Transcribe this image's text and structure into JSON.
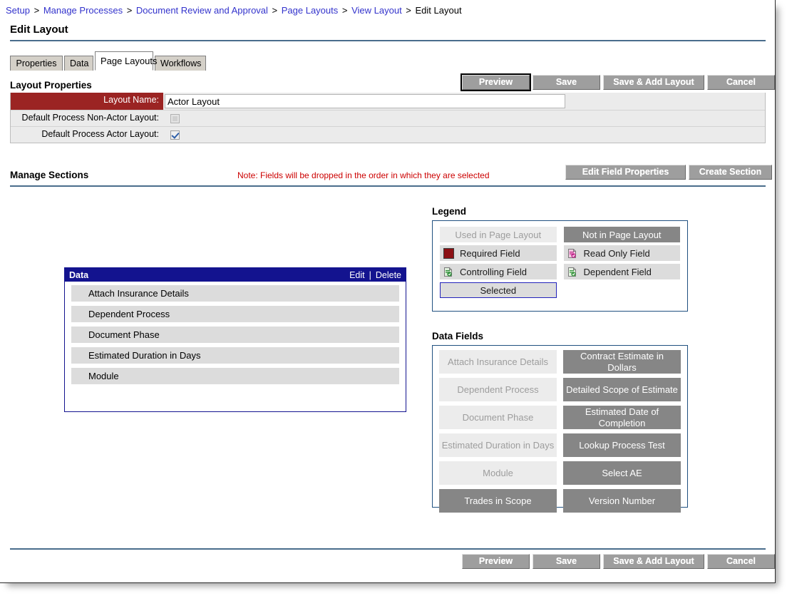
{
  "breadcrumb": {
    "items": [
      {
        "label": "Setup",
        "link": true
      },
      {
        "label": "Manage Processes",
        "link": true
      },
      {
        "label": "Document Review and Approval",
        "link": true
      },
      {
        "label": "Page Layouts",
        "link": true
      },
      {
        "label": "View Layout",
        "link": true
      },
      {
        "label": "Edit Layout",
        "link": false
      }
    ],
    "separator": ">"
  },
  "page": {
    "title": "Edit Layout"
  },
  "tabs": [
    {
      "label": "Properties",
      "active": false
    },
    {
      "label": "Data",
      "active": false
    },
    {
      "label": "Page Layouts",
      "active": true
    },
    {
      "label": "Workflows",
      "active": false
    }
  ],
  "layout_properties": {
    "heading": "Layout Properties",
    "rows": [
      {
        "label": "Layout Name:",
        "required": true,
        "type": "text",
        "value": "Actor Layout",
        "placeholder": ""
      },
      {
        "label": "Default Process Non-Actor Layout:",
        "required": false,
        "type": "checkbox",
        "checked": false,
        "disabled": true
      },
      {
        "label": "Default Process Actor Layout:",
        "required": false,
        "type": "checkbox",
        "checked": true,
        "disabled": false
      }
    ]
  },
  "top_buttons": [
    {
      "label": "Preview",
      "focused": true
    },
    {
      "label": "Save",
      "focused": false
    },
    {
      "label": "Save & Add Layout",
      "focused": false
    },
    {
      "label": "Cancel",
      "focused": false
    }
  ],
  "bottom_buttons": [
    {
      "label": "Preview",
      "focused": false
    },
    {
      "label": "Save",
      "focused": false
    },
    {
      "label": "Save & Add Layout",
      "focused": false
    },
    {
      "label": "Cancel",
      "focused": false
    }
  ],
  "manage_sections": {
    "heading": "Manage Sections",
    "note": "Note: Fields will be dropped in the order in which they are selected",
    "buttons": [
      {
        "label": "Edit Field Properties"
      },
      {
        "label": "Create Section"
      }
    ]
  },
  "section_panel": {
    "title": "Data",
    "edit_label": "Edit",
    "delete_label": "Delete",
    "separator": "|",
    "fields": [
      "Attach Insurance Details",
      "Dependent Process",
      "Document Phase",
      "Estimated Duration in Days",
      "Module"
    ]
  },
  "legend": {
    "heading": "Legend",
    "rows": [
      [
        {
          "label": "Used in Page Layout",
          "style": "used",
          "icon": null
        },
        {
          "label": "Not in Page Layout",
          "style": "notused",
          "icon": null
        }
      ],
      [
        {
          "label": "Required Field",
          "style": "item",
          "icon": "required-square-icon"
        },
        {
          "label": "Read Only Field",
          "style": "item",
          "icon": "read-only-document-icon"
        }
      ],
      [
        {
          "label": "Controlling Field",
          "style": "item",
          "icon": "controlling-document-icon"
        },
        {
          "label": "Dependent Field",
          "style": "item",
          "icon": "dependent-document-icon"
        }
      ],
      [
        {
          "label": "Selected",
          "style": "selected",
          "icon": null
        },
        {
          "label": "",
          "style": "empty",
          "icon": null
        }
      ]
    ],
    "colors": {
      "required_swatch": "#8b0f13",
      "used_bg": "#ececec",
      "notused_bg": "#868686",
      "selected_border": "#2222bb",
      "panel_border": "#205080"
    }
  },
  "data_fields": {
    "heading": "Data Fields",
    "rows": [
      [
        {
          "label": "Attach Insurance Details",
          "state": "used"
        },
        {
          "label": "Contract Estimate in Dollars",
          "state": "notused"
        }
      ],
      [
        {
          "label": "Dependent Process",
          "state": "used"
        },
        {
          "label": "Detailed Scope of Estimate",
          "state": "notused"
        }
      ],
      [
        {
          "label": "Document Phase",
          "state": "used"
        },
        {
          "label": "Estimated Date of Completion",
          "state": "notused"
        }
      ],
      [
        {
          "label": "Estimated Duration in Days",
          "state": "used"
        },
        {
          "label": "Lookup Process Test",
          "state": "notused"
        }
      ],
      [
        {
          "label": "Module",
          "state": "used"
        },
        {
          "label": "Select AE",
          "state": "notused"
        }
      ],
      [
        {
          "label": "Trades in Scope",
          "state": "notused"
        },
        {
          "label": "Version Number",
          "state": "notused"
        }
      ]
    ]
  },
  "theme": {
    "link_color": "#3333cc",
    "rule_color": "#4a6d8c",
    "required_label_bg": "#9b2423",
    "panel_header_bg": "#13138f",
    "note_color": "#cc0000"
  }
}
